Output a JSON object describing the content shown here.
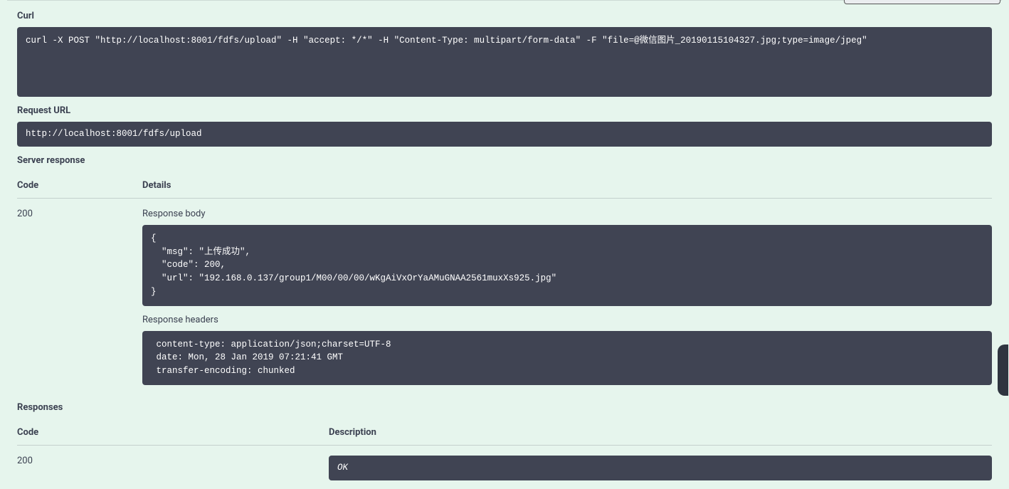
{
  "curl": {
    "label": "Curl",
    "command": "curl -X POST \"http://localhost:8001/fdfs/upload\" -H \"accept: */*\" -H \"Content-Type: multipart/form-data\" -F \"file=@微信图片_20190115104327.jpg;type=image/jpeg\""
  },
  "request_url": {
    "label": "Request URL",
    "value": "http://localhost:8001/fdfs/upload"
  },
  "server_response": {
    "label": "Server response",
    "code_header": "Code",
    "details_header": "Details",
    "code": "200",
    "response_body_label": "Response body",
    "response_body": "{\n  \"msg\": \"上传成功\",\n  \"code\": 200,\n  \"url\": \"192.168.0.137/group1/M00/00/00/wKgAiVxOrYaAMuGNAA2561muxXs925.jpg\"\n}",
    "response_headers_label": "Response headers",
    "response_headers": " content-type: application/json;charset=UTF-8\n date: Mon, 28 Jan 2019 07:21:41 GMT\n transfer-encoding: chunked"
  },
  "responses": {
    "label": "Responses",
    "code_header": "Code",
    "description_header": "Description",
    "rows": [
      {
        "code": "200",
        "description": "OK"
      }
    ]
  }
}
